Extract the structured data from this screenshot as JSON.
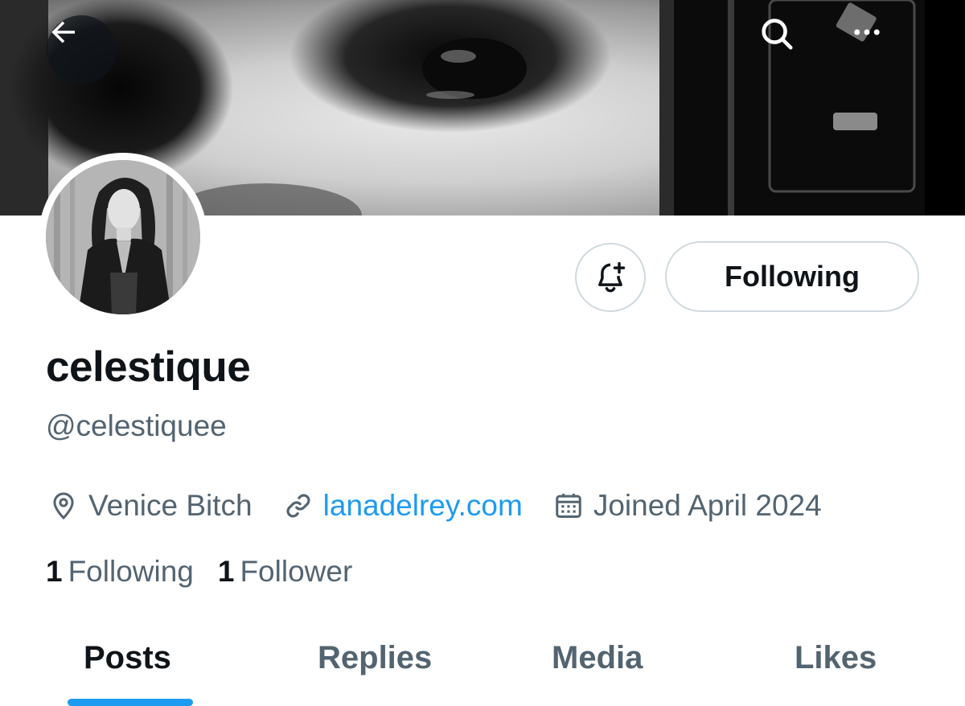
{
  "header": {
    "back_icon": "arrow-left-icon",
    "search_icon": "search-icon",
    "more_icon": "more-horizontal-icon"
  },
  "actions": {
    "notify_icon": "bell-plus-icon",
    "following_label": "Following"
  },
  "profile": {
    "display_name": "celestique",
    "handle": "@celestiquee",
    "location": "Venice Bitch",
    "website": "lanadelrey.com",
    "joined": "Joined April 2024"
  },
  "stats": {
    "following_count": "1",
    "following_label": "Following",
    "followers_count": "1",
    "followers_label": "Follower"
  },
  "tabs": [
    {
      "label": "Posts",
      "active": true
    },
    {
      "label": "Replies",
      "active": false
    },
    {
      "label": "Media",
      "active": false
    },
    {
      "label": "Likes",
      "active": false
    }
  ],
  "colors": {
    "accent": "#1d9bf0",
    "text_primary": "#0f1419",
    "text_secondary": "#536471",
    "border": "#cfd9de"
  }
}
